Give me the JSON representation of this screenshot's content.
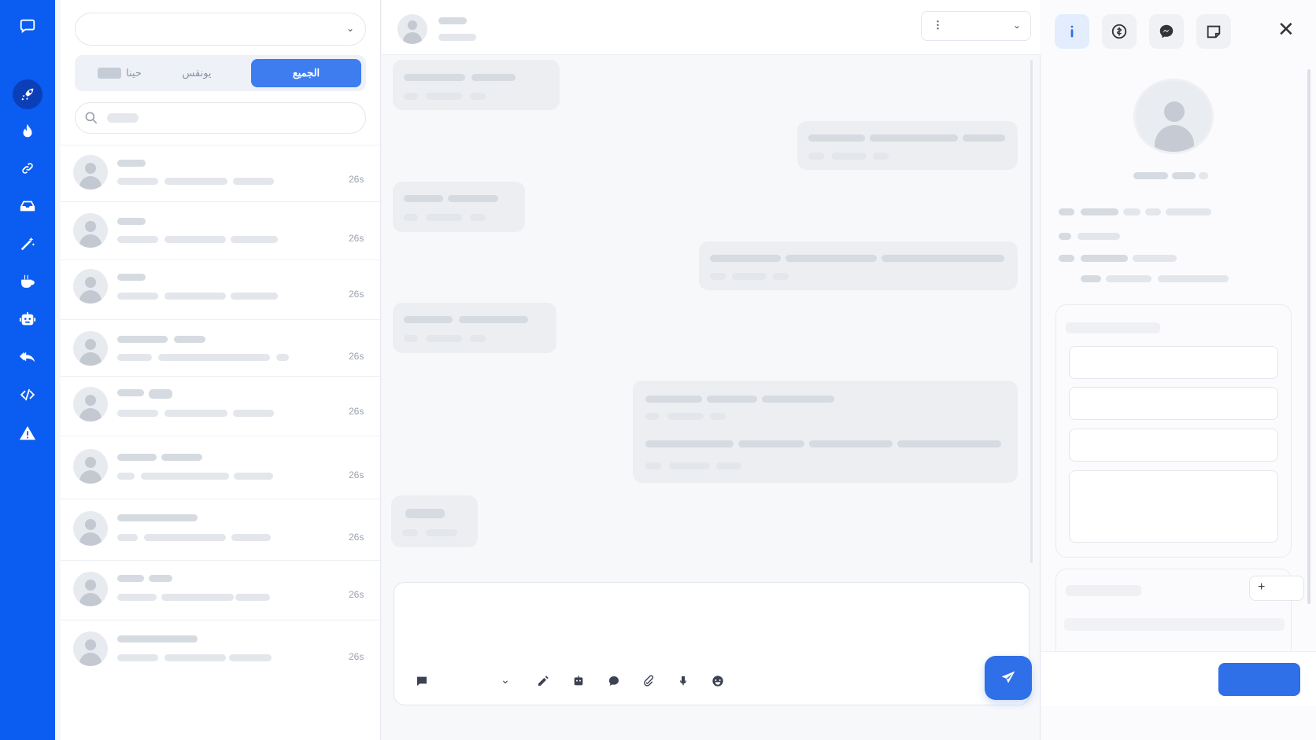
{
  "filters": {
    "tabs": [
      {
        "label": "الجميع",
        "active": true
      },
      {
        "label": "يونقس",
        "active": false
      },
      {
        "label": "حينا",
        "active": false
      }
    ]
  },
  "conversations": [
    {
      "time": "26s"
    },
    {
      "time": "26s"
    },
    {
      "time": "26s"
    },
    {
      "time": "26s"
    },
    {
      "time": "26s"
    },
    {
      "time": "26s"
    },
    {
      "time": "26s"
    },
    {
      "time": "26s"
    },
    {
      "time": "26s"
    }
  ],
  "chat": {
    "header_menu_glyph": "⋮",
    "contact_info": {
      "add_label": "+"
    }
  },
  "icons": {
    "rail": [
      "chat-bubble-icon",
      "rocket-icon",
      "fire-icon",
      "link-icon",
      "inbox-icon",
      "magic-wand-icon",
      "coffee-icon",
      "robot-icon",
      "reply-icon",
      "code-icon",
      "warning-icon"
    ],
    "composer": [
      "message-icon",
      "chevron-down-icon",
      "pen-icon",
      "robot-icon",
      "chat-icon",
      "attachment-icon",
      "microphone-icon",
      "emoji-icon",
      "send-icon"
    ],
    "info_tabs": [
      "info-icon",
      "dollar-icon",
      "messenger-icon",
      "note-icon",
      "close-icon"
    ]
  },
  "colors": {
    "brand": "#0b5cf0",
    "accent": "#2f6fe8"
  }
}
